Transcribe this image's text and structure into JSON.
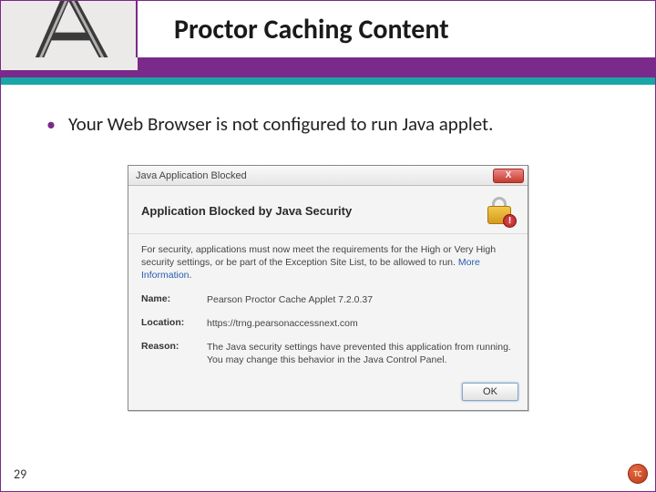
{
  "header": {
    "title": "Proctor Caching Content"
  },
  "bullet": {
    "text": "Your Web Browser is not configured to run Java applet."
  },
  "dialog": {
    "window_title": "Java Application Blocked",
    "close_label": "X",
    "heading": "Application Blocked by Java Security",
    "intro": "For security, applications must now meet the requirements for the High or Very High security settings, or be part of the Exception Site List, to be allowed to run. ",
    "more_info": "More Information",
    "name_label": "Name:",
    "name_value": "Pearson Proctor Cache Applet 7.2.0.37",
    "location_label": "Location:",
    "location_value": "https://trng.pearsonaccessnext.com",
    "reason_label": "Reason:",
    "reason_value": "The Java security settings have prevented this application from running. You may change this behavior in the Java Control Panel.",
    "ok_label": "OK"
  },
  "footer": {
    "page_number": "29",
    "badge": "TC"
  }
}
